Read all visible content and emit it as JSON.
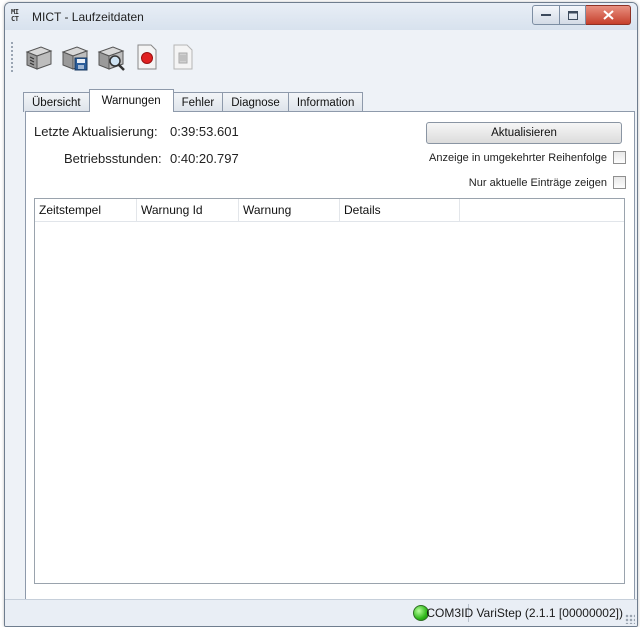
{
  "window": {
    "logo_lines": [
      "MI",
      "CT"
    ],
    "title": "MICT - Laufzeitdaten"
  },
  "toolbar": {
    "buttons": [
      {
        "icon": "device-read-icon"
      },
      {
        "icon": "device-save-icon"
      },
      {
        "icon": "device-search-icon"
      },
      {
        "icon": "record-icon",
        "color": "#e02020"
      },
      {
        "icon": "stop-icon",
        "disabled": true
      }
    ]
  },
  "tabs": [
    {
      "label": "Übersicht",
      "active": false
    },
    {
      "label": "Warnungen",
      "active": true
    },
    {
      "label": "Fehler",
      "active": false
    },
    {
      "label": "Diagnose",
      "active": false
    },
    {
      "label": "Information",
      "active": false
    }
  ],
  "panel": {
    "last_update_label": "Letzte Aktualisierung:",
    "last_update_value": "0:39:53.601",
    "operating_hours_label": "Betriebsstunden:",
    "operating_hours_value": "0:40:20.797",
    "refresh_button": "Aktualisieren",
    "reverse_order_label": "Anzeige in umgekehrter Reihenfolge",
    "reverse_order_checked": false,
    "current_only_label": "Nur aktuelle Einträge zeigen",
    "current_only_checked": false,
    "table": {
      "columns": [
        "Zeitstempel",
        "Warnung Id",
        "Warnung",
        "Details"
      ],
      "rows": []
    }
  },
  "statusbar": {
    "port": "COM3",
    "device": "ID VariStep (2.1.1 [00000002])",
    "led_color": "#2fb81a"
  }
}
